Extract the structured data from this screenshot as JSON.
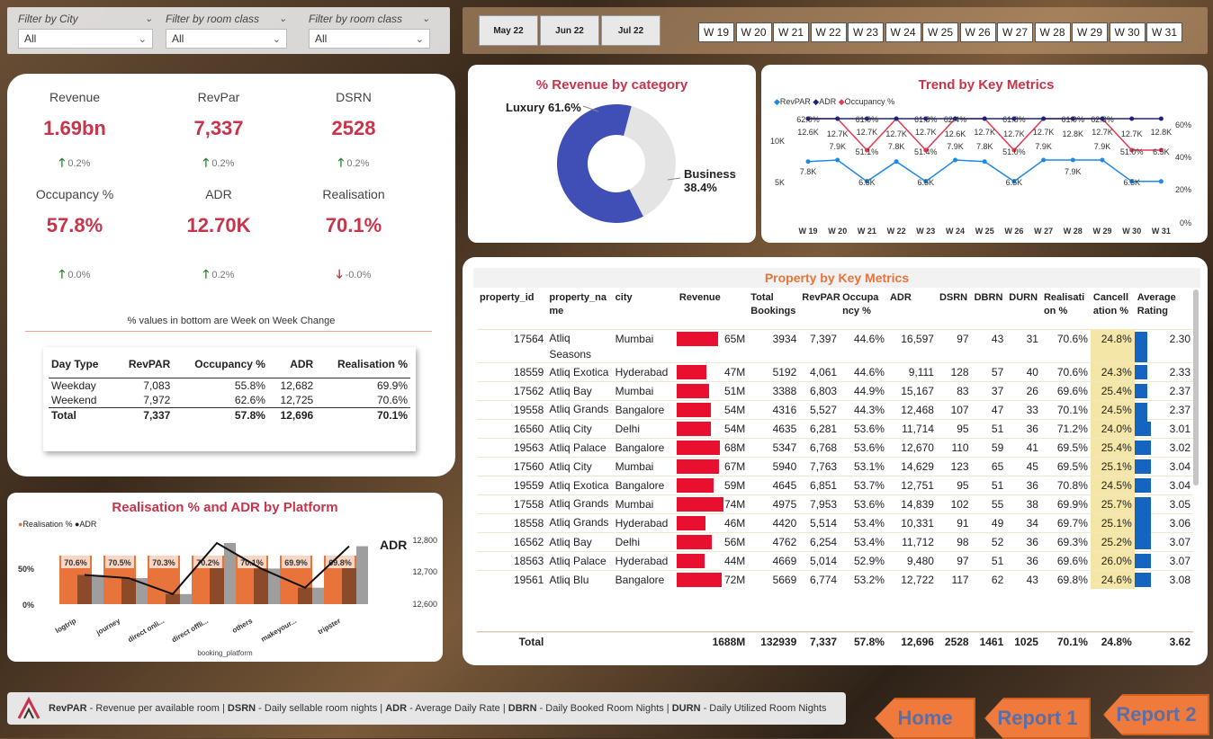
{
  "filters": [
    {
      "label": "Filter by City",
      "value": "All"
    },
    {
      "label": "Filter by room class",
      "value": "All"
    },
    {
      "label": "Filter by room class",
      "value": "All"
    }
  ],
  "months": [
    "May 22",
    "Jun 22",
    "Jul 22"
  ],
  "weeks": [
    "W 19",
    "W 20",
    "W 21",
    "W 22",
    "W 23",
    "W 24",
    "W 25",
    "W 26",
    "W 27",
    "W 28",
    "W 29",
    "W 30",
    "W 31"
  ],
  "kpis": [
    {
      "title": "Revenue",
      "value": "1.69bn",
      "change": "0.2%",
      "dir": "up"
    },
    {
      "title": "RevPar",
      "value": "7,337",
      "change": "0.2%",
      "dir": "up"
    },
    {
      "title": "DSRN",
      "value": "2528",
      "change": "0.2%",
      "dir": "up"
    },
    {
      "title": "Occupancy %",
      "value": "57.8%",
      "change": "0.0%",
      "dir": "up"
    },
    {
      "title": "ADR",
      "value": "12.70K",
      "change": "0.2%",
      "dir": "up"
    },
    {
      "title": "Realisation",
      "value": "70.1%",
      "change": "-0.0%",
      "dir": "down"
    }
  ],
  "kpi_note": "% values in bottom are Week on Week Change",
  "daytype": {
    "headers": [
      "Day Type",
      "RevPAR",
      "Occupancy %",
      "ADR",
      "Realisation %"
    ],
    "rows": [
      [
        "Weekday",
        "7,083",
        "55.8%",
        "12,682",
        "69.9%"
      ],
      [
        "Weekend",
        "7,972",
        "62.6%",
        "12,725",
        "70.6%"
      ]
    ],
    "total": [
      "Total",
      "7,337",
      "57.8%",
      "12,696",
      "70.1%"
    ]
  },
  "donut": {
    "title": "% Revenue by category",
    "slices": [
      {
        "label": "Luxury",
        "pct": 61.6,
        "text": "61.6%",
        "color": "#3f4fb5"
      },
      {
        "label": "Business",
        "pct": 38.4,
        "text": "38.4%",
        "color": "#e4e4e4"
      }
    ]
  },
  "trend": {
    "title": "Trend by Key Metrics",
    "legend": [
      "RevPAR",
      "ADR",
      "Occupancy %"
    ],
    "weeks": [
      "W 19",
      "W 20",
      "W 21",
      "W 22",
      "W 23",
      "W 24",
      "W 25",
      "W 26",
      "W 27",
      "W 28",
      "W 29",
      "W 30",
      "W 31"
    ],
    "yleft": [
      "10K",
      "5K"
    ],
    "yright": [
      "60%",
      "40%",
      "20%",
      "0%"
    ],
    "occ_labels": [
      "62.0%",
      "",
      "61.9%",
      "",
      "61.8%",
      "62.4%",
      "",
      "61.8%",
      "",
      "61.9%",
      "62.3%",
      "",
      ""
    ],
    "adr_labels": [
      "12.6K",
      "12.7K",
      "12.7K",
      "12.7K",
      "12.7K",
      "12.6K",
      "12.7K",
      "12.7K",
      "12.7K",
      "12.8K",
      "12.7K",
      "12.7K",
      "12.8K"
    ],
    "revpar_labels": [
      "7.8K",
      "",
      "6.5K",
      "",
      "6.5K",
      "",
      "",
      "6.5K",
      "",
      "7.9K",
      "",
      "6.5K",
      ""
    ],
    "extra_labels": [
      "",
      "7.9K",
      "",
      "7.8K",
      "",
      "7.9K",
      "7.8K",
      "",
      "7.9K",
      "",
      "7.9K",
      "",
      ""
    ],
    "occ2_labels": [
      "",
      "",
      "51.1%",
      "",
      "51.4%",
      "",
      "",
      "51.0%",
      "",
      "",
      "",
      "51.0%",
      "6.5K"
    ],
    "revpar": [
      7.8,
      7.9,
      6.5,
      7.8,
      6.5,
      7.9,
      7.8,
      6.5,
      7.9,
      7.9,
      7.9,
      6.5,
      6.5
    ],
    "adr": [
      12.6,
      12.7,
      12.7,
      12.7,
      12.7,
      12.6,
      12.7,
      12.7,
      12.7,
      12.8,
      12.7,
      12.7,
      12.8
    ],
    "occ": [
      62.0,
      61.9,
      51.1,
      61.9,
      51.4,
      62.4,
      61.8,
      51.0,
      61.9,
      61.9,
      62.3,
      51.0,
      51.0
    ]
  },
  "platform": {
    "title": "Realisation % and ADR by Platform",
    "legend": [
      "Realisation %",
      "ADR"
    ],
    "adr_title": "ADR",
    "categories": [
      "logtrip",
      "journey",
      "direct onli...",
      "direct offli...",
      "others",
      "makeyour...",
      "tripster"
    ],
    "real": [
      "70.6%",
      "70.5%",
      "70.3%",
      "70.2%",
      "70.1%",
      "69.9%",
      "69.8%"
    ],
    "adr": [
      12700,
      12690,
      12640,
      12800,
      12720,
      12660,
      12790
    ],
    "yleft": [
      "50%",
      "0%"
    ],
    "yright": [
      "12,800",
      "12,700",
      "12,600"
    ],
    "xlabel": "booking_platform"
  },
  "property": {
    "title": "Property by Key Metrics",
    "headers": [
      "property_id",
      "property_na me",
      "city",
      "Revenue",
      "Total Bookings",
      "RevPAR",
      "Occupa ncy %",
      "ADR",
      "DSRN",
      "DBRN",
      "DURN",
      "Realisati on %",
      "Cancell ation %",
      "Average Rating"
    ],
    "rows": [
      [
        "17564",
        "Atliq Seasons",
        "Mumbai",
        "65M",
        "3934",
        "7,397",
        "44.6%",
        "16,597",
        "97",
        "43",
        "31",
        "70.6%",
        "24.8%",
        "2.30"
      ],
      [
        "18559",
        "Atliq Exotica",
        "Hyderabad",
        "47M",
        "5192",
        "4,061",
        "44.6%",
        "9,111",
        "128",
        "57",
        "40",
        "70.6%",
        "24.3%",
        "2.33"
      ],
      [
        "17562",
        "Atliq Bay",
        "Mumbai",
        "51M",
        "3388",
        "6,803",
        "44.9%",
        "15,167",
        "83",
        "37",
        "26",
        "69.6%",
        "25.4%",
        "2.37"
      ],
      [
        "19558",
        "Atliq Grands",
        "Bangalore",
        "54M",
        "4316",
        "5,527",
        "44.3%",
        "12,468",
        "107",
        "47",
        "33",
        "70.1%",
        "24.5%",
        "2.37"
      ],
      [
        "16560",
        "Atliq City",
        "Delhi",
        "54M",
        "4635",
        "6,281",
        "53.6%",
        "11,714",
        "95",
        "51",
        "36",
        "71.2%",
        "24.0%",
        "3.01"
      ],
      [
        "19563",
        "Atliq Palace",
        "Bangalore",
        "68M",
        "5347",
        "6,768",
        "53.6%",
        "12,670",
        "110",
        "59",
        "41",
        "69.5%",
        "25.4%",
        "3.02"
      ],
      [
        "17560",
        "Atliq City",
        "Mumbai",
        "67M",
        "5940",
        "7,763",
        "53.1%",
        "14,629",
        "123",
        "65",
        "45",
        "69.5%",
        "25.1%",
        "3.04"
      ],
      [
        "19559",
        "Atliq Exotica",
        "Bangalore",
        "59M",
        "4645",
        "6,851",
        "53.7%",
        "12,751",
        "95",
        "51",
        "36",
        "70.8%",
        "24.5%",
        "3.04"
      ],
      [
        "17558",
        "Atliq Grands",
        "Mumbai",
        "74M",
        "4975",
        "7,953",
        "53.6%",
        "14,839",
        "102",
        "55",
        "38",
        "69.9%",
        "25.7%",
        "3.05"
      ],
      [
        "18558",
        "Atliq Grands",
        "Hyderabad",
        "46M",
        "4420",
        "5,514",
        "53.4%",
        "10,331",
        "91",
        "49",
        "34",
        "69.7%",
        "25.1%",
        "3.06"
      ],
      [
        "16562",
        "Atliq Bay",
        "Delhi",
        "56M",
        "4762",
        "6,254",
        "53.4%",
        "11,712",
        "98",
        "52",
        "36",
        "69.3%",
        "25.2%",
        "3.07"
      ],
      [
        "18563",
        "Atliq Palace",
        "Hyderabad",
        "44M",
        "4669",
        "5,014",
        "52.9%",
        "9,480",
        "97",
        "51",
        "36",
        "69.6%",
        "26.0%",
        "3.07"
      ],
      [
        "19561",
        "Atliq Blu",
        "Bangalore",
        "72M",
        "5669",
        "6,774",
        "53.2%",
        "12,722",
        "117",
        "62",
        "43",
        "69.8%",
        "24.6%",
        "3.08"
      ]
    ],
    "total": [
      "Total",
      "",
      "",
      "1688M",
      "132939",
      "7,337",
      "57.8%",
      "12,696",
      "2528",
      "1461",
      "1025",
      "70.1%",
      "24.8%",
      "3.62"
    ]
  },
  "footer": [
    {
      "k": "RevPAR",
      "v": " - Revenue per available room | "
    },
    {
      "k": "DSRN",
      "v": " - Daily sellable room nights | "
    },
    {
      "k": "ADR",
      "v": " - Average Daily Rate | "
    },
    {
      "k": "DBRN",
      "v": " - Daily Booked Room Nights | "
    },
    {
      "k": "DURN",
      "v": " - Daily Utilized Room Nights"
    }
  ],
  "nav": [
    "Home",
    "Report 1",
    "Report 2"
  ],
  "colors": {
    "accent": "#c8344a",
    "donut_primary": "#3f4fb5",
    "bar_red": "#e8102e",
    "rating_blue": "#1565c0",
    "cancel_yellow": "#f3e6a6",
    "orange": "#e8743b"
  }
}
